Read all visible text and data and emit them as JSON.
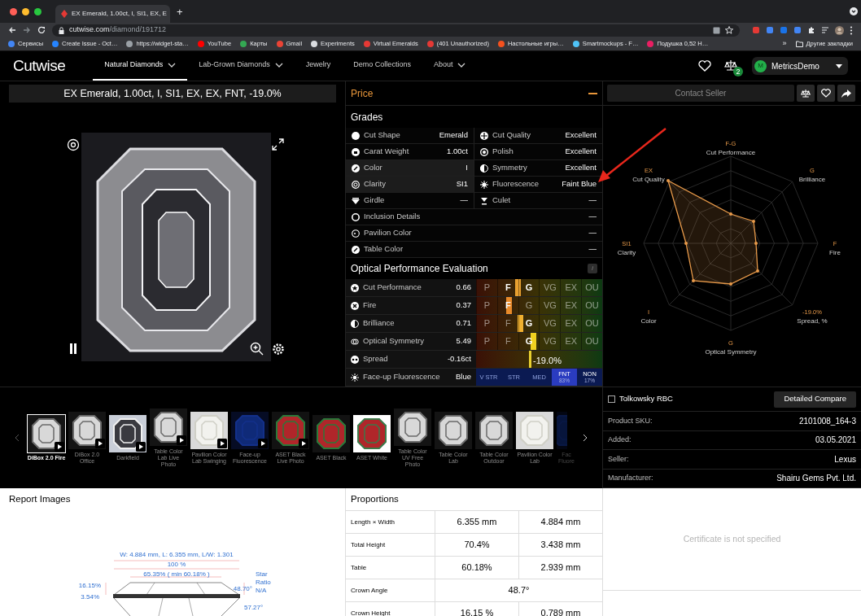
{
  "browser": {
    "tab_title": "EX Emerald, 1.00ct, I, SI1, EX, E",
    "new_tab": "+",
    "url_host": "cutwise.com",
    "url_path": "/diamond/191712",
    "bookmarks": [
      {
        "label": "Сервисы",
        "color": "#4285f4"
      },
      {
        "label": "Create Issue - Oct…",
        "color": "#2684ff"
      },
      {
        "label": "https://widget-sta…",
        "color": "#9aa0a6"
      },
      {
        "label": "YouTube",
        "color": "#ff0000"
      },
      {
        "label": "Карты",
        "color": "#34a853"
      },
      {
        "label": "Gmail",
        "color": "#ea4335"
      },
      {
        "label": "Experiments",
        "color": "#dadce0"
      },
      {
        "label": "Virtual Emeralds",
        "color": "#e53935"
      },
      {
        "label": "(401 Unauthorized)",
        "color": "#e53935"
      },
      {
        "label": "Настольные игры…",
        "color": "#f4511e"
      },
      {
        "label": "Smartmockups - F…",
        "color": "#4fc3f7"
      },
      {
        "label": "Подушка 0,52 Н…",
        "color": "#e91e63"
      }
    ],
    "more": "»",
    "other_bookmarks": "Другие закладки"
  },
  "nav": {
    "logo": "Cutwise",
    "items": [
      {
        "label": "Natural Diamonds",
        "dropdown": true,
        "selected": true
      },
      {
        "label": "Lab-Grown Diamonds",
        "dropdown": true,
        "selected": false
      },
      {
        "label": "Jewelry",
        "dropdown": false,
        "selected": false
      },
      {
        "label": "Demo Collections",
        "dropdown": false,
        "selected": false
      },
      {
        "label": "About",
        "dropdown": true,
        "selected": false
      }
    ],
    "compare_count": "2",
    "user": {
      "initial": "M",
      "name": "MetricsDemo"
    }
  },
  "product_title": "EX Emerald, 1.00ct, I, SI1, EX, EX, FNT, -19.0%",
  "price": {
    "title": "Price"
  },
  "grades": {
    "title": "Grades",
    "rows": [
      {
        "cells": [
          {
            "label": "Cut Shape",
            "value": "Emerald",
            "highlighted": false
          },
          {
            "label": "Cut Quality",
            "value": "Excellent",
            "highlighted": false
          }
        ]
      },
      {
        "cells": [
          {
            "label": "Carat Weight",
            "value": "1.00ct",
            "highlighted": false
          },
          {
            "label": "Polish",
            "value": "Excellent",
            "highlighted": false
          }
        ]
      },
      {
        "cells": [
          {
            "label": "Color",
            "value": "I",
            "highlighted": true
          },
          {
            "label": "Symmetry",
            "value": "Excellent",
            "highlighted": false
          }
        ]
      },
      {
        "cells": [
          {
            "label": "Clarity",
            "value": "SI1",
            "highlighted": true
          },
          {
            "label": "Fluorescence",
            "value": "Faint Blue",
            "highlighted": false
          }
        ]
      },
      {
        "cells": [
          {
            "label": "Girdle",
            "value": "—",
            "highlighted": false
          },
          {
            "label": "Culet",
            "value": "—",
            "highlighted": false
          }
        ]
      },
      {
        "cells": [
          {
            "label": "Inclusion Details",
            "value": "—",
            "highlighted": false
          }
        ]
      },
      {
        "cells": [
          {
            "label": "Pavilion Color",
            "value": "—",
            "highlighted": false
          }
        ]
      },
      {
        "cells": [
          {
            "label": "Table Color",
            "value": "—",
            "highlighted": false
          }
        ]
      }
    ]
  },
  "performance": {
    "title": "Optical Performance Evaluation",
    "info": "i",
    "rows": [
      {
        "kind": "grade",
        "label": "Cut Performance",
        "value": "0.66",
        "level": 0.33,
        "color": "#e8a030",
        "scale": [
          {
            "label": "P",
            "selected": false
          },
          {
            "label": "F",
            "selected": true
          },
          {
            "label": "G",
            "selected": true
          },
          {
            "label": "VG",
            "selected": false
          },
          {
            "label": "EX",
            "selected": false
          },
          {
            "label": "OU",
            "selected": false
          }
        ]
      },
      {
        "kind": "grade",
        "label": "Fire",
        "value": "0.37",
        "level": 0.26,
        "color": "#e88a2a",
        "scale": [
          {
            "label": "P",
            "selected": false
          },
          {
            "label": "F",
            "selected": true
          },
          {
            "label": "G",
            "selected": false
          },
          {
            "label": "VG",
            "selected": false
          },
          {
            "label": "EX",
            "selected": false
          },
          {
            "label": "OU",
            "selected": false
          }
        ]
      },
      {
        "kind": "grade",
        "label": "Brilliance",
        "value": "0.71",
        "level": 0.35,
        "color": "#f0b030",
        "scale": [
          {
            "label": "P",
            "selected": false
          },
          {
            "label": "F",
            "selected": false
          },
          {
            "label": "G",
            "selected": true
          },
          {
            "label": "VG",
            "selected": false
          },
          {
            "label": "EX",
            "selected": false
          },
          {
            "label": "OU",
            "selected": false
          }
        ]
      },
      {
        "kind": "grade",
        "label": "Optical Symmetry",
        "value": "5.49",
        "level": 0.45,
        "color": "#f0d020",
        "scale": [
          {
            "label": "P",
            "selected": false
          },
          {
            "label": "F",
            "selected": false
          },
          {
            "label": "G",
            "selected": true
          },
          {
            "label": "VG",
            "selected": false
          },
          {
            "label": "EX",
            "selected": false
          },
          {
            "label": "OU",
            "selected": false
          }
        ]
      },
      {
        "kind": "spread",
        "label": "Spread",
        "value": "-0.16ct",
        "level": 0.42,
        "color": "#e8d030",
        "reading": "-19.0%"
      },
      {
        "kind": "fluorescence",
        "label": "Face-up Fluorescence",
        "value": "Blue",
        "scale": [
          {
            "label": "V STR",
            "selected": false
          },
          {
            "label": "STR",
            "selected": false
          },
          {
            "label": "MED",
            "selected": false
          },
          {
            "label": "FNT",
            "share": "83%",
            "selected": true
          },
          {
            "label": "NON",
            "share": "17%",
            "selected": false
          }
        ]
      }
    ]
  },
  "seller": {
    "contact": "Contact Seller"
  },
  "radar": {
    "axes": [
      {
        "grade": "F-G",
        "name": "Cut Performance"
      },
      {
        "grade": "G",
        "name": "Brilliance"
      },
      {
        "grade": "F",
        "name": "Fire"
      },
      {
        "grade": "-19.0%",
        "name": "Spread, %"
      },
      {
        "grade": "G",
        "name": "Optical Symmetry"
      },
      {
        "grade": "I",
        "name": "Color"
      },
      {
        "grade": "SI1",
        "name": "Clarity"
      },
      {
        "grade": "EX",
        "name": "Cut Quality"
      }
    ]
  },
  "media": {
    "items": [
      {
        "label": "DiBox 2.0 Fire",
        "kind": "dark",
        "video": true,
        "selected": true
      },
      {
        "label": "DiBox 2.0 Office",
        "kind": "dark",
        "video": true,
        "selected": false
      },
      {
        "label": "Darkfield",
        "kind": "light",
        "video": true,
        "selected": false
      },
      {
        "label": "Table Color Lab Live Photo",
        "kind": "dark",
        "video": true,
        "selected": false
      },
      {
        "label": "Pavilion Color Lab Swinging",
        "kind": "white",
        "video": true,
        "selected": false
      },
      {
        "label": "Face-up Fluorescence",
        "kind": "blue",
        "video": true,
        "selected": false
      },
      {
        "label": "ASET Black Live Photo",
        "kind": "aset",
        "video": true,
        "selected": false
      },
      {
        "label": "ASET Black",
        "kind": "aset",
        "video": false,
        "selected": false
      },
      {
        "label": "ASET White",
        "kind": "aset-white",
        "video": false,
        "selected": false
      },
      {
        "label": "Table Color UV Free Photo",
        "kind": "dark",
        "video": false,
        "selected": false
      },
      {
        "label": "Table Color Lab",
        "kind": "dark",
        "video": false,
        "selected": false
      },
      {
        "label": "Table Color Outdoor",
        "kind": "dark",
        "video": false,
        "selected": false
      },
      {
        "label": "Pavilion Color Lab",
        "kind": "white",
        "video": false,
        "selected": false
      },
      {
        "label": "Fac Fluore",
        "kind": "blue",
        "selected": false
      }
    ]
  },
  "info": {
    "tolkowsky": {
      "label": "Tolkowsky RBC",
      "checked": false
    },
    "compare": "Detailed Compare",
    "rows": [
      {
        "label": "Product SKU:",
        "value": "2101008_164-3"
      },
      {
        "label": "Added:",
        "value": "03.05.2021"
      },
      {
        "label": "Seller:",
        "value": "Lexus"
      },
      {
        "label": "Manufacturer:",
        "value": "Shairu Gems Pvt. Ltd."
      }
    ]
  },
  "report": {
    "title": "Report Images",
    "labels": [
      "W: 4.884 mm, L: 6.355 mm, L/W: 1.301",
      "100 %",
      "65.35% ( min 60.18% )",
      "16.15%",
      "3.54%",
      "48.70°",
      "Star",
      "Ratio",
      "N/A",
      "57.27°"
    ]
  },
  "proportions": {
    "title": "Proportions",
    "rows": [
      {
        "label": "Length × Width",
        "values": [
          "6.355 mm",
          "4.884 mm"
        ]
      },
      {
        "label": "Total Height",
        "values": [
          "70.4%",
          "3.438 mm"
        ]
      },
      {
        "label": "Table",
        "values": [
          "60.18%",
          "2.939 mm"
        ]
      },
      {
        "label": "Crown Angle",
        "values": [
          "48.7°"
        ]
      },
      {
        "label": "Crown Height",
        "values": [
          "16.15 %",
          "0.789 mm"
        ]
      }
    ]
  },
  "certificate": {
    "text": "Certificate is not specified"
  }
}
